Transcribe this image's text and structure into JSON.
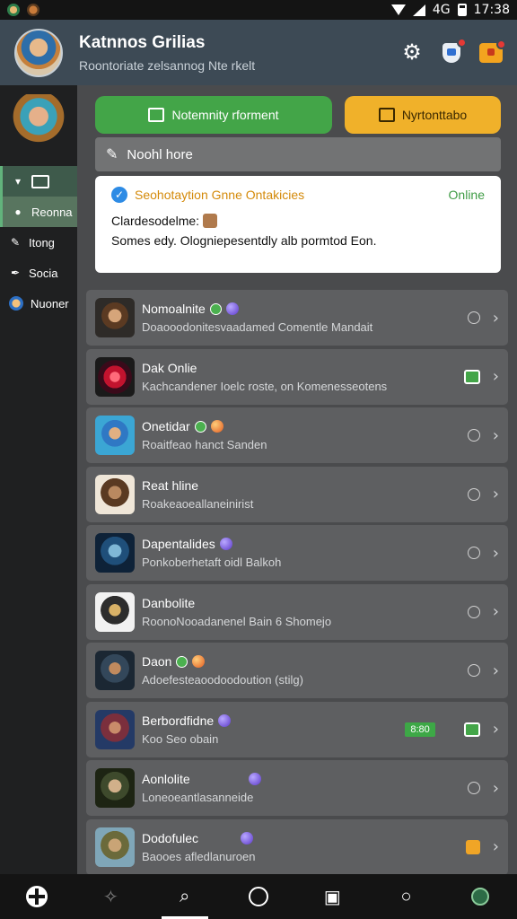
{
  "status_bar": {
    "time": "17:38",
    "network": "4G"
  },
  "header": {
    "title": "Katnnos Grilias",
    "subtitle": "Roontoriate zelsannog Nte rkelt"
  },
  "sidebar": {
    "items": [
      {
        "label": ""
      },
      {
        "label": "Reonna"
      },
      {
        "label": "Itong"
      },
      {
        "label": "Socia"
      },
      {
        "label": "Nuoner"
      }
    ]
  },
  "actions": {
    "primary_label": "Notemnity rforment",
    "secondary_label": "Nyrtonttabo"
  },
  "section": {
    "label": "Noohl hore"
  },
  "status_card": {
    "title": "Seohotaytion Gnne Ontakicies",
    "online_label": "Online",
    "line1": "Clardesodelme:",
    "line2": "Somes edy. Ologniepesentdly alb pormtod Eon."
  },
  "friends": [
    {
      "name": "Nomoalnite",
      "status": "Doaooodonitesvaadamed Comentle Mandait",
      "presence": "green-purple",
      "end": "clock"
    },
    {
      "name": "Dak Onlie",
      "status": "Kachcandener Ioelc roste, on Komenesseotens",
      "presence": "",
      "end": "green-square"
    },
    {
      "name": "Onetidar",
      "status": "Roaitfeao hanct Sanden",
      "presence": "green-orange",
      "end": "clock"
    },
    {
      "name": "Reat hline",
      "status": "Roakeaoeallaneinirist",
      "presence": "",
      "end": "clock"
    },
    {
      "name": "Dapentalides",
      "status": "Ponkoberhetaft oidl Balkoh",
      "presence": "purple",
      "end": "clock"
    },
    {
      "name": "Danbolite",
      "status": "RoonoNooadanenel Bain 6 Shomejo",
      "presence": "",
      "end": "clock"
    },
    {
      "name": "Daon",
      "status": "Adoefesteaoodoodoution (stilg)",
      "presence": "green-orange",
      "end": "clock"
    },
    {
      "name": "Berbordfidne",
      "status": "Koo Seo obain",
      "presence": "purple",
      "end": "green-square",
      "tag": "8:80"
    },
    {
      "name": "Aonlolite",
      "status": "Loneoeantlasanneide",
      "presence": "purple",
      "end": "clock"
    },
    {
      "name": "Dodofulec",
      "status": "Baooes afledlanuroen",
      "presence": "purple",
      "end": "orange-square"
    }
  ],
  "colors": {
    "accent_green": "#43a548",
    "accent_yellow": "#f0b12a",
    "header_bg": "#3d4a55"
  }
}
